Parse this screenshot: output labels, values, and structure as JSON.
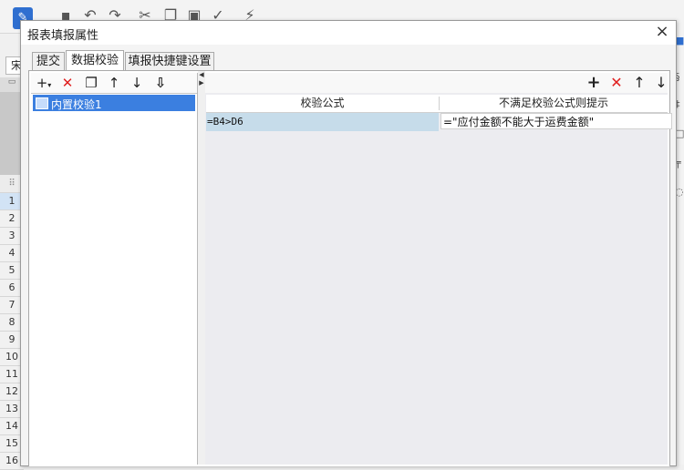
{
  "app": {
    "font_box": "宋",
    "row_numbers": [
      "1",
      "2",
      "3",
      "4",
      "5",
      "6",
      "7",
      "8",
      "9",
      "10",
      "11",
      "12",
      "13",
      "14",
      "15",
      "16"
    ],
    "selected_row": "1"
  },
  "dialog": {
    "title": "报表填报属性",
    "close": "×",
    "tabs": [
      "提交",
      "数据校验",
      "填报快捷键设置"
    ],
    "active_tab": "数据校验"
  },
  "left_list": {
    "items": [
      {
        "label": "内置校验1",
        "selected": true
      }
    ]
  },
  "right_grid": {
    "columns": [
      "校验公式",
      "不满足校验公式则提示"
    ],
    "rows": [
      {
        "formula": "=B4>D6",
        "message": "=\"应付金额不能大于运费金额\""
      }
    ]
  },
  "icons": {
    "add": "plus-icon",
    "delete": "x-icon",
    "copy": "copy-icon",
    "up": "arrow-up-icon",
    "down": "arrow-down-icon",
    "bottom": "move-bottom-icon",
    "accent_red": "#e02020",
    "selection_blue": "#3b7fe0"
  }
}
